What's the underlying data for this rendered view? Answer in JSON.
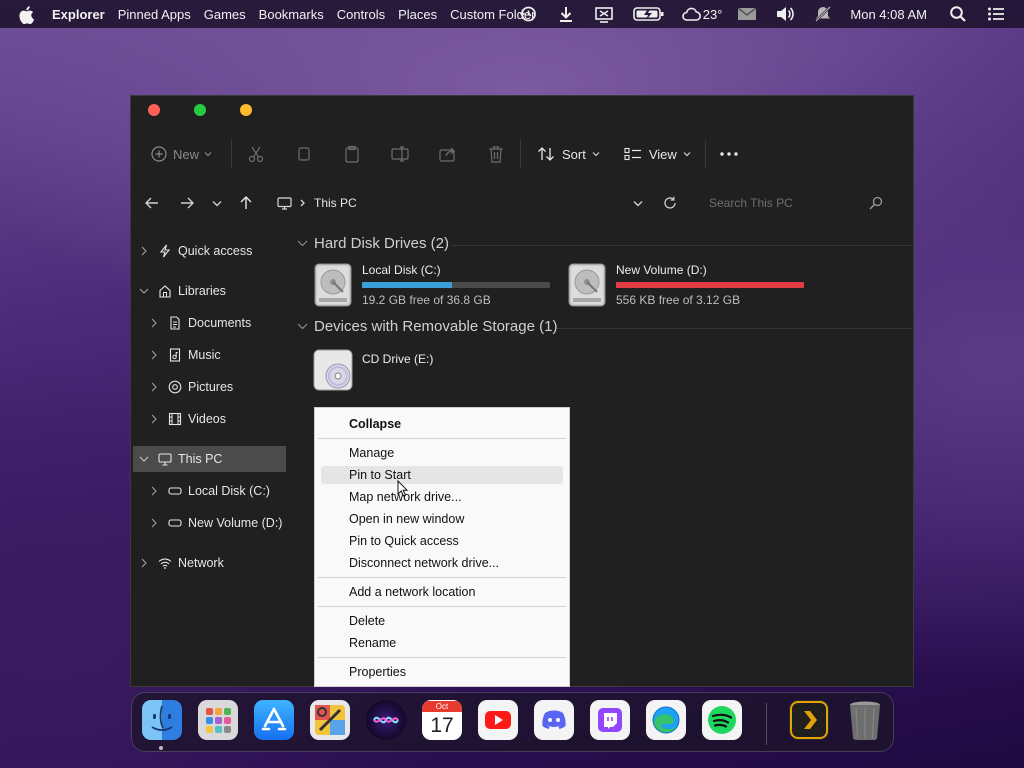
{
  "menubar": {
    "app_name": "Explorer",
    "items": [
      "Pinned Apps",
      "Games",
      "Bookmarks",
      "Controls",
      "Places",
      "Custom Folder"
    ],
    "weather": "23°",
    "clock": "Mon 4:08 AM",
    "icons": [
      "apple-logo-icon",
      "history-icon",
      "download-icon",
      "screen-share-icon",
      "battery-charging-icon",
      "cloud-icon",
      "mail-icon",
      "volume-icon",
      "notifications-off-icon",
      "search-icon",
      "list-icon"
    ]
  },
  "toolbar": {
    "new_label": "New",
    "sort_label": "Sort",
    "view_label": "View",
    "icons": [
      "cut-icon",
      "copy-icon",
      "paste-icon",
      "rename-icon",
      "share-icon",
      "delete-icon"
    ]
  },
  "address": {
    "breadcrumb": "This PC",
    "search_placeholder": "Search This PC"
  },
  "sidebar": {
    "items": [
      {
        "label": "Quick access",
        "icon": "lightning-icon"
      },
      {
        "label": "Libraries",
        "icon": "library-icon"
      },
      {
        "label": "Documents",
        "icon": "document-icon"
      },
      {
        "label": "Music",
        "icon": "music-icon"
      },
      {
        "label": "Pictures",
        "icon": "pictures-icon"
      },
      {
        "label": "Videos",
        "icon": "videos-icon"
      },
      {
        "label": "This PC",
        "icon": "computer-icon"
      },
      {
        "label": "Local Disk (C:)",
        "icon": "drive-icon"
      },
      {
        "label": "New Volume (D:)",
        "icon": "drive-icon"
      },
      {
        "label": "Network",
        "icon": "network-icon"
      }
    ]
  },
  "content": {
    "hdd_header": "Hard Disk Drives (2)",
    "removable_header": "Devices with Removable Storage (1)",
    "drives": [
      {
        "name": "Local Disk (C:)",
        "free": "19.2 GB free of 36.8 GB",
        "used_fraction": 0.48,
        "bar_color": "#3aa0d8"
      },
      {
        "name": "New Volume (D:)",
        "free": "556 KB free of 3.12 GB",
        "used_fraction": 0.999,
        "bar_color": "#e23d45"
      }
    ],
    "cd_drive": "CD Drive (E:)"
  },
  "context_menu": {
    "items": [
      "Collapse",
      "Manage",
      "Pin to Start",
      "Map network drive...",
      "Open in new window",
      "Pin to Quick access",
      "Disconnect network drive...",
      "Add a network location",
      "Delete",
      "Rename",
      "Properties"
    ],
    "highlighted": "Pin to Start"
  },
  "dock": {
    "apps": [
      "finder-icon",
      "launchpad-icon",
      "app-store-icon",
      "system-preferences-icon",
      "siri-icon",
      "calendar-icon",
      "youtube-icon",
      "discord-icon",
      "twitch-icon",
      "edge-icon",
      "spotify-icon",
      "plex-icon",
      "trash-icon"
    ],
    "calendar_month": "Oct",
    "calendar_day": "17"
  }
}
